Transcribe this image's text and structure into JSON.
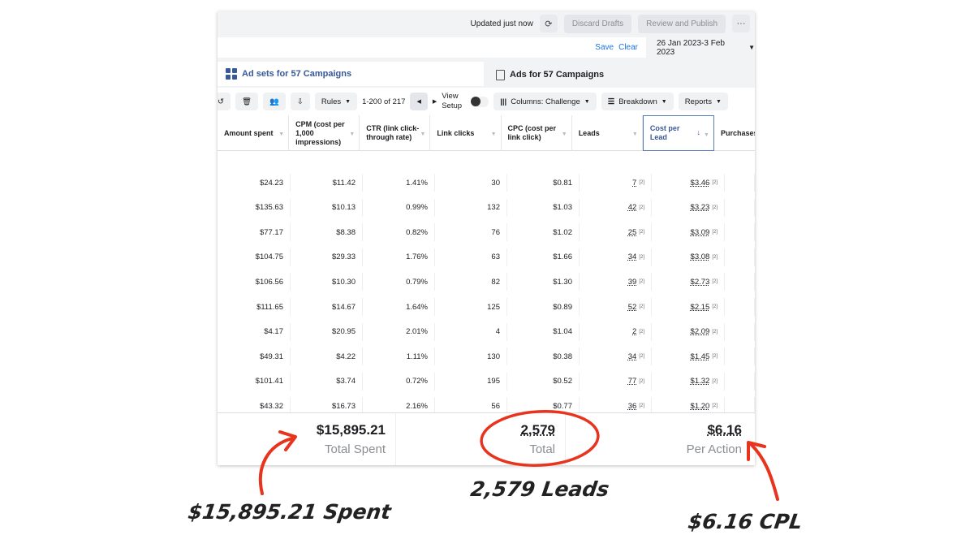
{
  "topbar": {
    "updated": "Updated just now",
    "discard": "Discard Drafts",
    "review": "Review and Publish",
    "more": "···"
  },
  "filter": {
    "save": "Save",
    "clear": "Clear",
    "date": "26 Jan 2023-3 Feb 2023"
  },
  "tabs": [
    {
      "label": "Ad sets for 57 Campaigns"
    },
    {
      "label": "Ads for 57 Campaigns"
    }
  ],
  "toolbar": {
    "rules": "Rules",
    "pagination": "1-200 of 217",
    "view_setup": "View Setup",
    "columns": "Columns: Challenge",
    "breakdown": "Breakdown",
    "reports": "Reports"
  },
  "columns": [
    "Amount spent",
    "CPM (cost per 1,000 impressions)",
    "CTR (link click-through rate)",
    "Link clicks",
    "CPC (cost per link click)",
    "Leads",
    "Cost per Lead",
    "Purchases"
  ],
  "rows": [
    [
      "$24.23",
      "$11.42",
      "1.41%",
      "30",
      "$0.81",
      "7",
      "$3.46"
    ],
    [
      "$135.63",
      "$10.13",
      "0.99%",
      "132",
      "$1.03",
      "42",
      "$3.23"
    ],
    [
      "$77.17",
      "$8.38",
      "0.82%",
      "76",
      "$1.02",
      "25",
      "$3.09"
    ],
    [
      "$104.75",
      "$29.33",
      "1.76%",
      "63",
      "$1.66",
      "34",
      "$3.08"
    ],
    [
      "$106.56",
      "$10.30",
      "0.79%",
      "82",
      "$1.30",
      "39",
      "$2.73"
    ],
    [
      "$111.65",
      "$14.67",
      "1.64%",
      "125",
      "$0.89",
      "52",
      "$2.15"
    ],
    [
      "$4.17",
      "$20.95",
      "2.01%",
      "4",
      "$1.04",
      "2",
      "$2.09"
    ],
    [
      "$49.31",
      "$4.22",
      "1.11%",
      "130",
      "$0.38",
      "34",
      "$1.45"
    ],
    [
      "$101.41",
      "$3.74",
      "0.72%",
      "195",
      "$0.52",
      "77",
      "$1.32"
    ],
    [
      "$43.32",
      "$16.73",
      "2.16%",
      "56",
      "$0.77",
      "36",
      "$1.20"
    ]
  ],
  "footer": [
    {
      "value": "$15,895.21",
      "label": "Total Spent"
    },
    {
      "value": "2,579",
      "label": "Total"
    },
    {
      "value": "$6.16",
      "label": "Per Action"
    }
  ],
  "annotations": {
    "spent": "$15,895.21 Spent",
    "leads": "2,579 Leads",
    "cpl": "$6.16 CPL",
    "color": "#e8341c"
  }
}
